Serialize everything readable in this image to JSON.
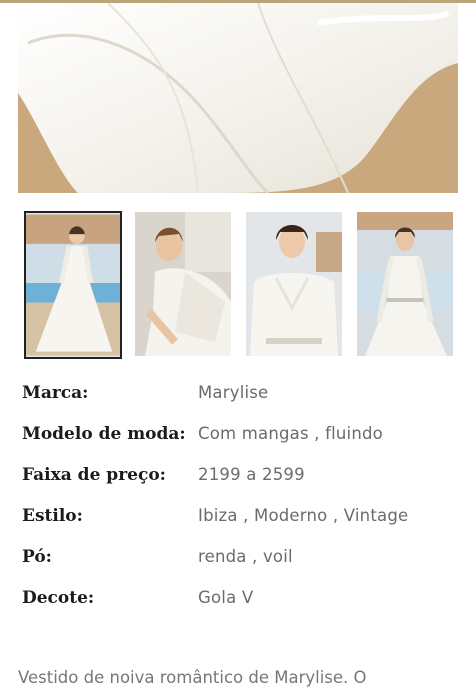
{
  "gallery": {
    "thumbnails": [
      {
        "alt": "dress-full-length"
      },
      {
        "alt": "dress-lace-sleeve"
      },
      {
        "alt": "dress-vneck-closeup"
      },
      {
        "alt": "dress-belt"
      }
    ],
    "selected_index": 0
  },
  "specs": [
    {
      "label": "Marca:",
      "value": "Marylise"
    },
    {
      "label": "Modelo de moda:",
      "value": "Com mangas , fluindo"
    },
    {
      "label": "Faixa de preço:",
      "value": "2199 a 2599"
    },
    {
      "label": "Estilo:",
      "value": "Ibiza , Moderno , Vintage"
    },
    {
      "label": "Pó:",
      "value": "renda , voil"
    },
    {
      "label": "Decote:",
      "value": "Gola V"
    }
  ],
  "description": "Vestido de noiva romântico de Marylise. O",
  "colors": {
    "accent": "#b8a57a",
    "label": "#1b1b1b",
    "value": "#6b6b6b"
  }
}
